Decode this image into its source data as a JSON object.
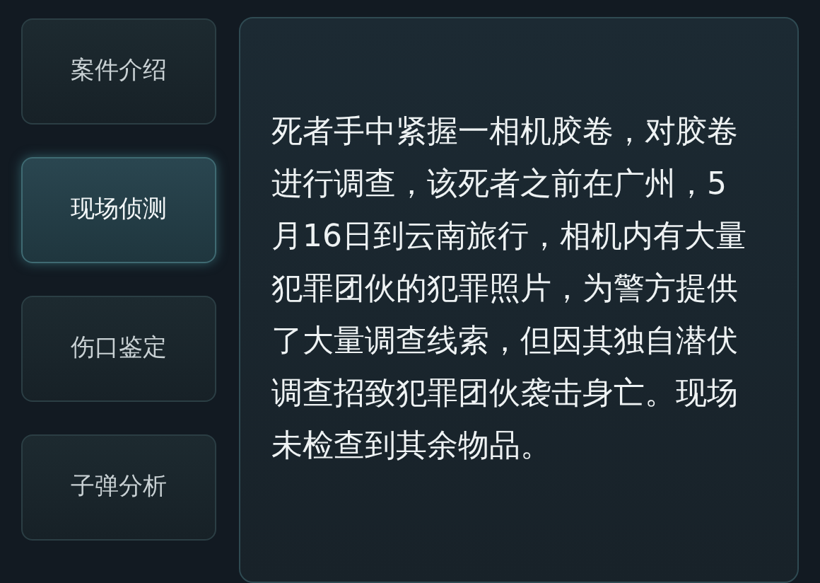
{
  "tabs": [
    {
      "label": "案件介绍",
      "selected": false
    },
    {
      "label": "现场侦测",
      "selected": true
    },
    {
      "label": "伤口鉴定",
      "selected": false
    },
    {
      "label": "子弹分析",
      "selected": false
    }
  ],
  "content": {
    "text": "死者手中紧握一相机胶卷，对胶卷进行调查，该死者之前在广州，5月16日到云南旅行，相机内有大量犯罪团伙的犯罪照片，为警方提供了大量调查线索，但因其独自潜伏调查招致犯罪团伙袭击身亡。现场未检查到其余物品。"
  }
}
